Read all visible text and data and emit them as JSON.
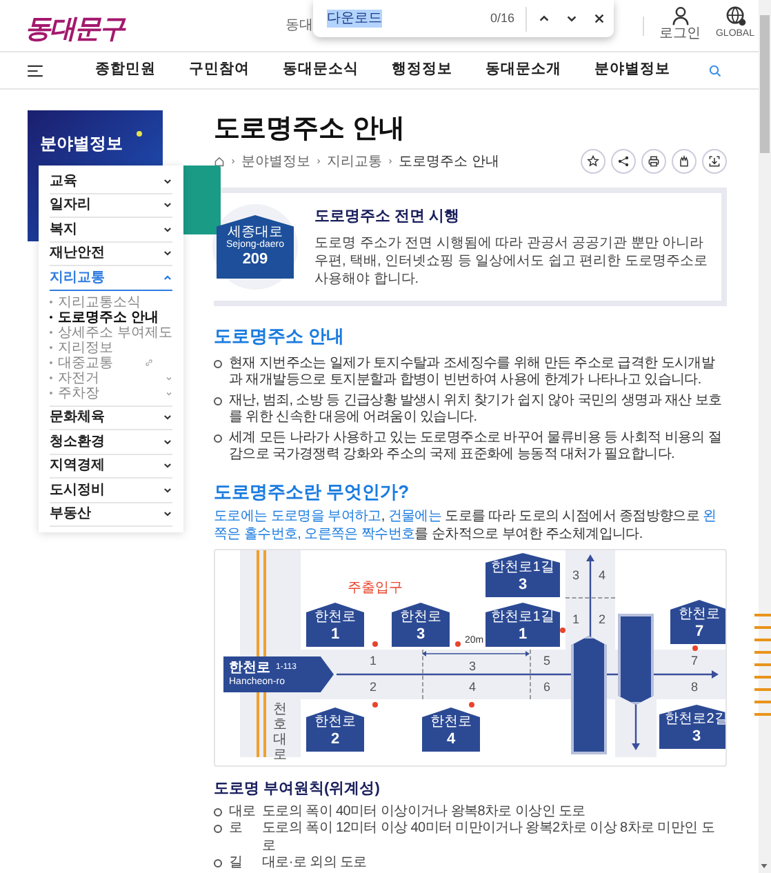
{
  "header": {
    "logo": "동대문구",
    "search_text": "동대",
    "account_links": [
      {
        "kind": "login",
        "label": "로그인"
      },
      {
        "kind": "global",
        "label": "GLOBAL"
      }
    ]
  },
  "find_bar": {
    "value": "다운로드",
    "count": "0/16"
  },
  "nav": {
    "items": [
      "종합민원",
      "구민참여",
      "동대문소식",
      "행정정보",
      "동대문소개",
      "분야별정보"
    ]
  },
  "sidebar": {
    "title": "분야별정보",
    "items": [
      {
        "label": "교육",
        "selected": false,
        "expanded": false
      },
      {
        "label": "일자리",
        "selected": false,
        "expanded": false
      },
      {
        "label": "복지",
        "selected": false,
        "expanded": false
      },
      {
        "label": "재난안전",
        "selected": false,
        "expanded": false
      },
      {
        "label": "지리교통",
        "selected": true,
        "expanded": true,
        "children": [
          {
            "label": "지리교통소식",
            "kind": "link",
            "selected": false
          },
          {
            "label": "도로명주소 안내",
            "kind": "link",
            "selected": true
          },
          {
            "label": "상세주소 부여제도",
            "kind": "link",
            "selected": false
          },
          {
            "label": "지리정보",
            "kind": "link",
            "selected": false
          },
          {
            "label": "대중교통",
            "kind": "external",
            "selected": false
          },
          {
            "label": "자전거",
            "kind": "submenu",
            "selected": false
          },
          {
            "label": "주차장",
            "kind": "submenu",
            "selected": false
          }
        ]
      },
      {
        "label": "문화체육",
        "selected": false,
        "expanded": false
      },
      {
        "label": "청소환경",
        "selected": false,
        "expanded": false
      },
      {
        "label": "지역경제",
        "selected": false,
        "expanded": false
      },
      {
        "label": "도시정비",
        "selected": false,
        "expanded": false
      },
      {
        "label": "부동산",
        "selected": false,
        "expanded": false
      }
    ]
  },
  "page": {
    "title": "도로명주소 안내",
    "breadcrumb": [
      "분야별정보",
      "지리교통",
      "도로명주소 안내"
    ]
  },
  "intro_box": {
    "sign_name": "세종대로",
    "sign_roman": "Sejong-daero",
    "sign_number": "209",
    "title": "도로명주소 전면 시행",
    "text": "도로명 주소가 전면 시행됨에 따라 관공서 공공기관 뿐만 아니라 우편, 택배, 인터넷쇼핑 등 일상에서도 쉽고 편리한 도로명주소로 사용해야 합니다."
  },
  "overview": {
    "heading": "도로명주소 안내",
    "bullets": [
      "현재 지번주소는 일제가 토지수탈과 조세징수를 위해 만든 주소로 급격한 도시개발과 재개발등으로 토지분할과 합병이 빈번하여 사용에 한계가 나타나고 있습니다.",
      "재난, 범죄, 소방 등 긴급상황 발생시 위치 찾기가 쉽지 않아 국민의 생명과 재산 보호를 위한 신속한 대응에 어려움이 있습니다.",
      "세계 모든 나라가 사용하고 있는 도로명주소로 바꾸어 물류비용 등 사회적 비용의 절감으로 국가경쟁력 강화와 주소의 국제 표준화에 능동적 대처가 필요합니다."
    ]
  },
  "definition": {
    "heading": "도로명주소란 무엇인가?",
    "text_parts": [
      {
        "text": "도로에는 도로명을 부여하고",
        "highlight": true
      },
      {
        "text": ", ",
        "highlight": false
      },
      {
        "text": "건물에는",
        "highlight": true
      },
      {
        "text": " 도로를 따라 도로의 시점에서 종점방향으로 ",
        "highlight": false
      },
      {
        "text": "왼쪽은 홀수번호, 오른쪽은 짝수번호",
        "highlight": true
      },
      {
        "text": "를 순차적으로 부여한 주소체계입니다.",
        "highlight": false
      }
    ]
  },
  "diagram": {
    "road_sign": {
      "name": "한천로",
      "roman": "Hancheon-ro",
      "range": "1-113"
    },
    "signs": [
      {
        "name": "한천로",
        "number": "1"
      },
      {
        "name": "한천로",
        "number": "3"
      },
      {
        "name": "한천로1길",
        "number": "3"
      },
      {
        "name": "한천로1길",
        "number": "1"
      },
      {
        "name": "한천로",
        "number": "7"
      },
      {
        "name": "한천로",
        "number": "2"
      },
      {
        "name": "한천로",
        "number": "4"
      },
      {
        "name": "한천로2길",
        "number": "3"
      }
    ],
    "lot_numbers": [
      "1",
      "2",
      "3",
      "4",
      "5",
      "6",
      "7",
      "8"
    ],
    "side_lot_numbers": [
      "3",
      "4",
      "1",
      "2"
    ],
    "entrance_label": "주출입구",
    "distance": "20m",
    "cross_road": "천호대로"
  },
  "principles": {
    "heading": "도로명 부여원칙(위계성)",
    "rows": [
      {
        "term": "대로",
        "text": "도로의 폭이 40미터 이상이거나 왕복8차로 이상인 도로"
      },
      {
        "term": "로",
        "text": "도로의 폭이 12미터 이상 40미터 미만이거나 왕복2차로 이상 8차로 미만인 도로"
      },
      {
        "term": "길",
        "text": "대로·로 외의 도로"
      }
    ]
  }
}
